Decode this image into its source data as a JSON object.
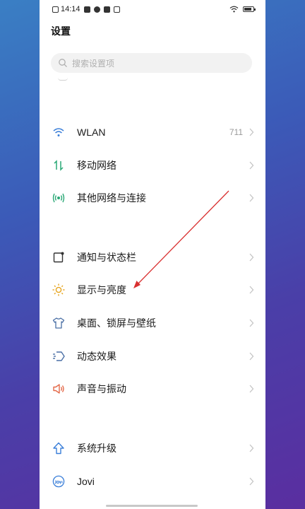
{
  "status_bar": {
    "time": "14:14"
  },
  "title": "设置",
  "search": {
    "placeholder": "搜索设置项"
  },
  "groups": [
    [
      {
        "label": "WLAN",
        "value": "711",
        "icon": "wifi-icon",
        "color": "#3b7fd9"
      },
      {
        "label": "移动网络",
        "value": "",
        "icon": "mobile-data-icon",
        "color": "#2aa876"
      },
      {
        "label": "其他网络与连接",
        "value": "",
        "icon": "network-connections-icon",
        "color": "#2aa876"
      }
    ],
    [
      {
        "label": "通知与状态栏",
        "value": "",
        "icon": "notification-icon",
        "color": "#333333"
      },
      {
        "label": "显示与亮度",
        "value": "",
        "icon": "brightness-icon",
        "color": "#e6a41e"
      },
      {
        "label": "桌面、锁屏与壁纸",
        "value": "",
        "icon": "wallpaper-icon",
        "color": "#4a6fa5"
      },
      {
        "label": "动态效果",
        "value": "",
        "icon": "motion-effects-icon",
        "color": "#4a6fa5"
      },
      {
        "label": "声音与振动",
        "value": "",
        "icon": "sound-icon",
        "color": "#e46a4a"
      }
    ],
    [
      {
        "label": "系统升级",
        "value": "",
        "icon": "system-update-icon",
        "color": "#3b7fd9"
      },
      {
        "label": "Jovi",
        "value": "",
        "icon": "jovi-icon",
        "color": "#3b7fd9"
      }
    ]
  ],
  "annotation": {
    "color": "#d93030"
  }
}
